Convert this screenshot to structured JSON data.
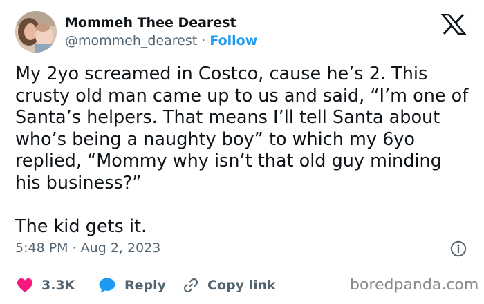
{
  "author": {
    "display_name": "Mommeh Thee Dearest",
    "handle": "@mommeh_dearest",
    "separator": "·",
    "follow_label": "Follow",
    "avatar_icon": "profile-photo-mother-and-baby"
  },
  "platform_icon": "x-logo",
  "tweet": {
    "text": "My 2yo screamed in Costco, cause he’s 2. This\ncrusty old man came up to us and said, “I’m one of\nSanta’s helpers. That means I’ll tell Santa about\nwho’s being a naughty boy” to which my 6yo\nreplied, “Mommy why isn’t that old guy minding\nhis business?”\n\nThe kid gets it.",
    "timestamp": "5:48 PM · Aug 2, 2023"
  },
  "actions": {
    "like_count": "3.3K",
    "reply_label": "Reply",
    "copy_link_label": "Copy link"
  },
  "icons": {
    "like": "heart-icon",
    "reply": "speech-bubble-icon",
    "copy": "link-icon",
    "info": "info-icon"
  },
  "colors": {
    "like": "#f91880",
    "reply": "#1d9bf0",
    "follow": "#1d9bf0",
    "secondary_text": "#536471",
    "primary_text": "#0f1419"
  },
  "watermark": "boredpanda.com"
}
